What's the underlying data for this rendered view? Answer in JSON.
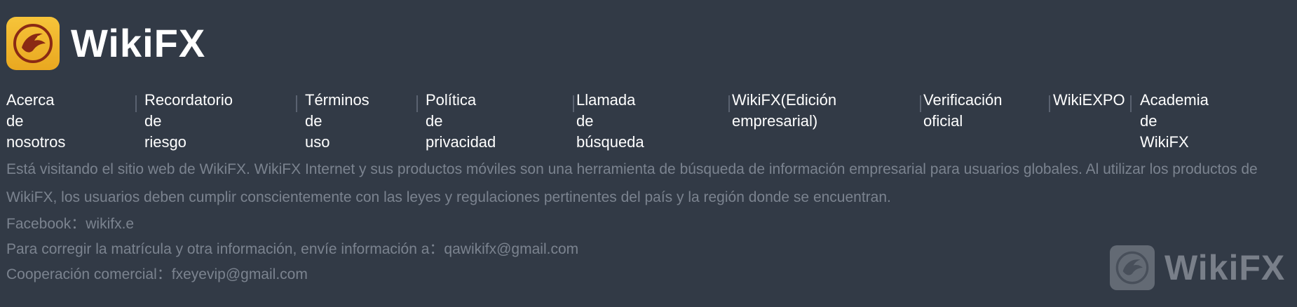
{
  "brand": {
    "name": "WikiFX",
    "logo_icon": "eagle-icon",
    "colors": {
      "badge": "#f6c43a",
      "badge_dark": "#e9a820",
      "eagle": "#8a2a14"
    }
  },
  "nav": {
    "items": [
      {
        "line1": "Acerca de",
        "line2": "nosotros"
      },
      {
        "line1": "Recordatorio de",
        "line2": "riesgo"
      },
      {
        "line1": "Términos de",
        "line2": "uso"
      },
      {
        "line1": "Política de",
        "line2": "privacidad"
      },
      {
        "line1": "Llamada de",
        "line2": "búsqueda"
      },
      {
        "line1": "WikiFX(Edición",
        "line2": "empresarial)"
      },
      {
        "line1": "Verificación",
        "line2": "oficial"
      },
      {
        "line1": "WikiEXPO",
        "line2": ""
      },
      {
        "line1": "Academia de",
        "line2": "WikiFX"
      }
    ]
  },
  "info": {
    "description": "Está visitando el sitio web de WikiFX. WikiFX Internet y sus productos móviles son una herramienta de búsqueda de información empresarial para usuarios globales. Al utilizar los productos de WikiFX, los usuarios deben cumplir conscientemente con las leyes y regulaciones pertinentes del país y la región donde se encuentran.",
    "facebook_label": "Facebook：",
    "facebook_value": "wikifx.e",
    "correction_label": "Para corregir la matrícula y otra información, envíe información a：",
    "correction_email": "qawikifx@gmail.com",
    "cooperation_label": "Cooperación comercial：",
    "cooperation_email": "fxeyevip@gmail.com"
  },
  "watermark": {
    "name": "WikiFX",
    "icon": "eagle-icon"
  }
}
